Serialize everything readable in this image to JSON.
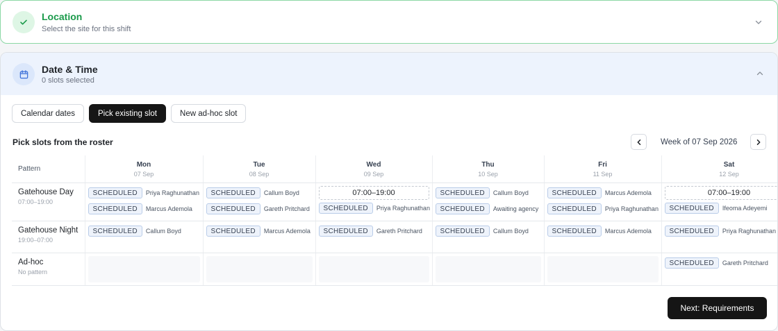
{
  "location": {
    "title": "Location",
    "subtitle": "Select the site for this shift",
    "status_color": "#1a9a4a"
  },
  "date_time": {
    "title": "Date & Time",
    "subtitle": "0 slots selected"
  },
  "tabs": [
    {
      "label": "Calendar dates",
      "active": false
    },
    {
      "label": "Pick existing slot",
      "active": true
    },
    {
      "label": "New ad-hoc slot",
      "active": false
    }
  ],
  "roster": {
    "title": "Pick slots from the roster",
    "week_label": "Week of 07 Sep 2026",
    "pattern_header": "Pattern",
    "days": [
      {
        "name": "Mon",
        "date": "07 Sep"
      },
      {
        "name": "Tue",
        "date": "08 Sep"
      },
      {
        "name": "Wed",
        "date": "09 Sep"
      },
      {
        "name": "Thu",
        "date": "10 Sep"
      },
      {
        "name": "Fri",
        "date": "11 Sep"
      },
      {
        "name": "Sat",
        "date": "12 Sep"
      }
    ],
    "badge_label": "SCHEDULED",
    "rows": [
      {
        "name": "Gatehouse Day",
        "time": "07:00–19:00",
        "cells": [
          {
            "open": "",
            "slots": [
              "Priya Raghunathan",
              "Marcus Ademola"
            ]
          },
          {
            "open": "",
            "slots": [
              "Callum Boyd",
              "Gareth Pritchard"
            ]
          },
          {
            "open": "07:00–19:00",
            "slots": [
              "Priya Raghunathan"
            ]
          },
          {
            "open": "",
            "slots": [
              "Callum Boyd",
              "Awaiting agency"
            ]
          },
          {
            "open": "",
            "slots": [
              "Marcus Ademola",
              "Priya Raghunathan"
            ]
          },
          {
            "open": "07:00–19:00",
            "slots": [
              "Ifeoma Adeyemi"
            ]
          }
        ]
      },
      {
        "name": "Gatehouse Night",
        "time": "19:00–07:00",
        "cells": [
          {
            "open": "",
            "slots": [
              "Callum Boyd"
            ]
          },
          {
            "open": "",
            "slots": [
              "Marcus Ademola"
            ]
          },
          {
            "open": "",
            "slots": [
              "Gareth Pritchard"
            ]
          },
          {
            "open": "",
            "slots": [
              "Callum Boyd"
            ]
          },
          {
            "open": "",
            "slots": [
              "Marcus Ademola"
            ]
          },
          {
            "open": "",
            "slots": [
              "Priya Raghunathan"
            ]
          }
        ]
      },
      {
        "name": "Ad-hoc",
        "time": "No pattern",
        "cells": [
          {
            "open": "",
            "slots": []
          },
          {
            "open": "",
            "slots": []
          },
          {
            "open": "",
            "slots": []
          },
          {
            "open": "",
            "slots": []
          },
          {
            "open": "",
            "slots": []
          },
          {
            "open": "",
            "slots": [
              "Gareth Pritchard"
            ]
          }
        ]
      }
    ]
  },
  "next_button": {
    "label": "Next: Requirements"
  }
}
